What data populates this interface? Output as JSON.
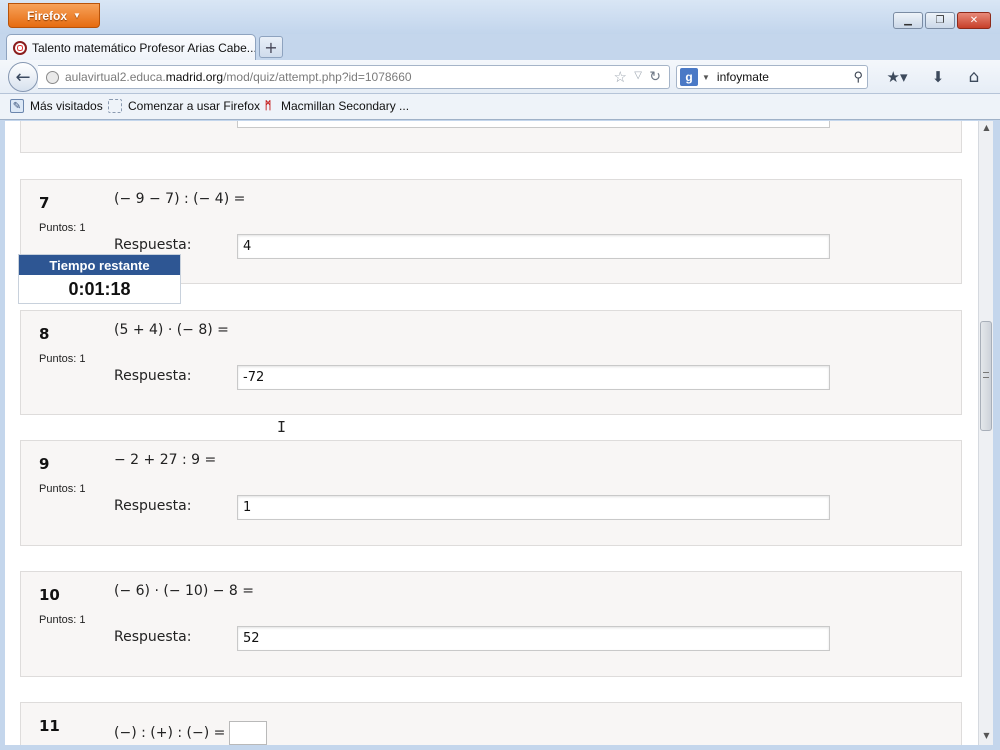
{
  "browser": {
    "menu_button": "Firefox",
    "tab_title": "Talento matemático Profesor Arias Cabe...",
    "new_tab": "+",
    "url_prefix": "aulavirtual2.educa.",
    "url_domain": "madrid.org",
    "url_path": "/mod/quiz/attempt.php?id=1078660",
    "search_value": "infoymate",
    "search_engine_icon": "google-icon",
    "bookmarks": [
      {
        "label": "Más visitados",
        "icon": "most-visited-icon"
      },
      {
        "label": "Comenzar a usar Firefox",
        "icon": "page-icon"
      },
      {
        "label": "Macmillan Secondary ...",
        "icon": "macmillan-logo-icon"
      }
    ]
  },
  "timer": {
    "label": "Tiempo restante",
    "value": "0:01:18"
  },
  "questions": [
    {
      "number": "7",
      "points": "Puntos: 1",
      "text": "(− 9 − 7) : (− 4) =",
      "answer_label": "Respuesta:",
      "answer": "4"
    },
    {
      "number": "8",
      "points": "Puntos: 1",
      "text": "(5 + 4) · (− 8) =",
      "answer_label": "Respuesta:",
      "answer": "-72"
    },
    {
      "number": "9",
      "points": "Puntos: 1",
      "text": "− 2 + 27 : 9 =",
      "answer_label": "Respuesta:",
      "answer": "1"
    },
    {
      "number": "10",
      "points": "Puntos: 1",
      "text": "(− 6) · (− 10) − 8 =",
      "answer_label": "Respuesta:",
      "answer": "52"
    },
    {
      "number": "11",
      "text": "(−) : (+) : (−) =",
      "answer": ""
    }
  ],
  "colors": {
    "timer_header": "#2e5693",
    "firefox_button": "#e66b10",
    "card_background": "#f8f6f5"
  }
}
